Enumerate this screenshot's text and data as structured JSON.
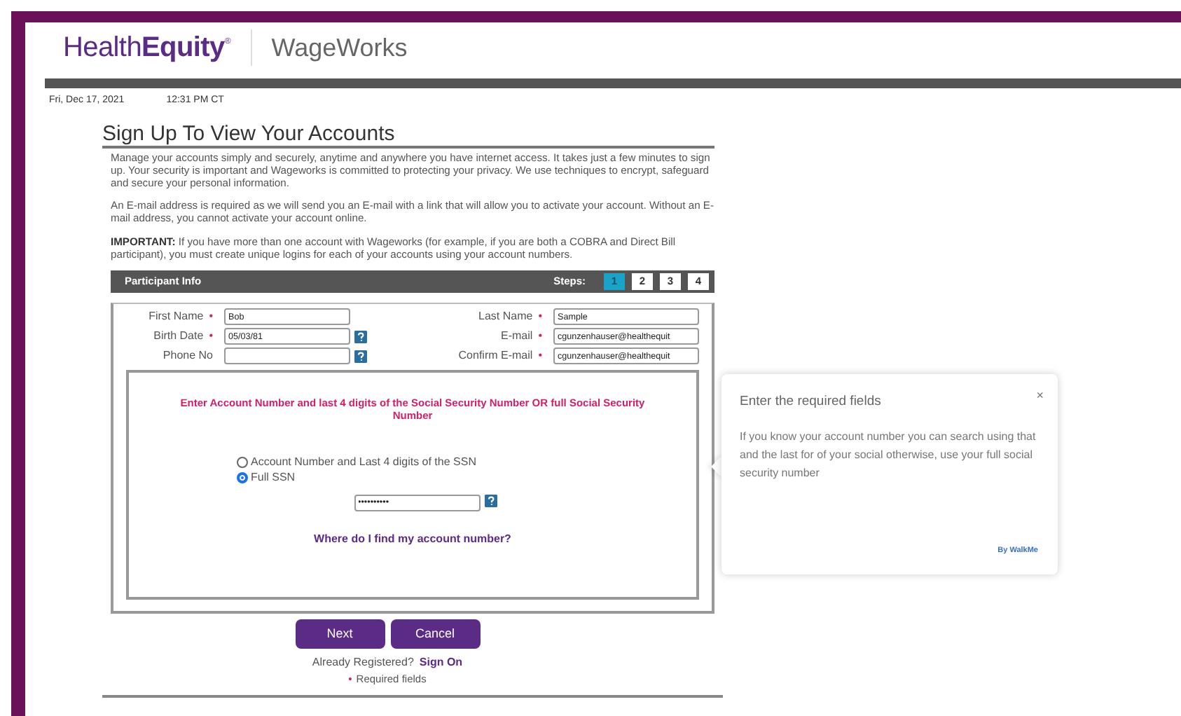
{
  "header": {
    "brand": "Health**Equity**",
    "brand_mark": "®",
    "partner": "WageWorks"
  },
  "date": "Fri, Dec 17, 2021",
  "time": "12:31 PM CT",
  "title": "Sign Up To View Your Accounts",
  "paragraphs": [
    "Manage your accounts simply and securely, anytime and anywhere you have internet access. It takes just a few minutes to sign up. Your security is important and Wageworks is committed to protecting your privacy. We use techniques to encrypt, safeguard and secure your personal information.",
    "An E-mail address is required as we will send you an E-mail with a link that will allow you to activate your account. Without an E-mail address, you cannot activate your account online.",
    "**IMPORTANT:** If you have more than one account with Wageworks (for example, if you are both a COBRA and Direct Bill participant), you must create unique logins for each of your accounts using your account numbers."
  ],
  "steps_bar": {
    "title": "Participant Info",
    "label": "Steps:",
    "steps": [
      {
        "label": "1",
        "selected": true
      },
      {
        "label": "2",
        "selected": false
      },
      {
        "label": "3",
        "selected": false
      },
      {
        "label": "4",
        "selected": false
      }
    ]
  },
  "required_mark": "•",
  "fields_left": [
    {
      "label": "First Name",
      "required": true,
      "value": "Bob",
      "help": false
    },
    {
      "label": "Birth Date",
      "required": true,
      "value": "05/03/81",
      "help": true
    },
    {
      "label": "Phone No",
      "required": false,
      "help": true
    }
  ],
  "fields_right": [
    {
      "label": "Last Name",
      "required": true,
      "value": "Sample"
    },
    {
      "label": "E-mail",
      "required": true,
      "value": "cgunzenhauser@healthequit"
    },
    {
      "label": "Confirm E-mail",
      "required": true,
      "value": "cgunzenhauser@healthequit"
    }
  ],
  "ssn_section": {
    "instruction": "Enter Account Number and last 4 digits of the Social Security Number OR full Social Security Number",
    "options": [
      {
        "label": "Account Number and Last 4 digits of the SSN",
        "selected": false
      },
      {
        "label": "Full SSN",
        "selected": true
      }
    ],
    "ssn_value": "••••••••••",
    "help": true,
    "link": "Where do I find my account number?"
  },
  "buttons": [
    "Next",
    "Cancel"
  ],
  "already": "Already Registered?",
  "sign_on": "Sign On",
  "required_note": "Required fields",
  "tooltip": {
    "title": "Enter the required fields",
    "body": "If you know your account number you can search using that and the last for of your social otherwise, use your full social security number",
    "close": "×",
    "footer": "By WalkMe"
  }
}
